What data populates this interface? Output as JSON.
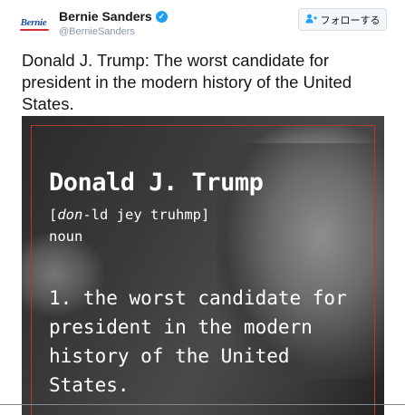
{
  "tweet": {
    "author_name": "Bernie Sanders",
    "author_handle": "@BernieSanders",
    "avatar_text": "Bernie",
    "follow_label": "フォローする",
    "text": "Donald J. Trump: The worst candidate for president in the modern history of the United States."
  },
  "image_card": {
    "term": "Donald J. Trump",
    "pron_open": "[",
    "pron_italic": "don",
    "pron_rest": "-ld jey truhmp]",
    "part_of_speech": "noun",
    "definition": "1. the worst candidate for president in the modern history of the United States."
  },
  "colors": {
    "verified": "#1da1f2",
    "frame": "#b33a2e",
    "avatar_text": "#1f4fa0",
    "avatar_swoosh": "#d62e3c"
  },
  "icons": [
    "verified-badge-icon",
    "add-user-icon"
  ]
}
